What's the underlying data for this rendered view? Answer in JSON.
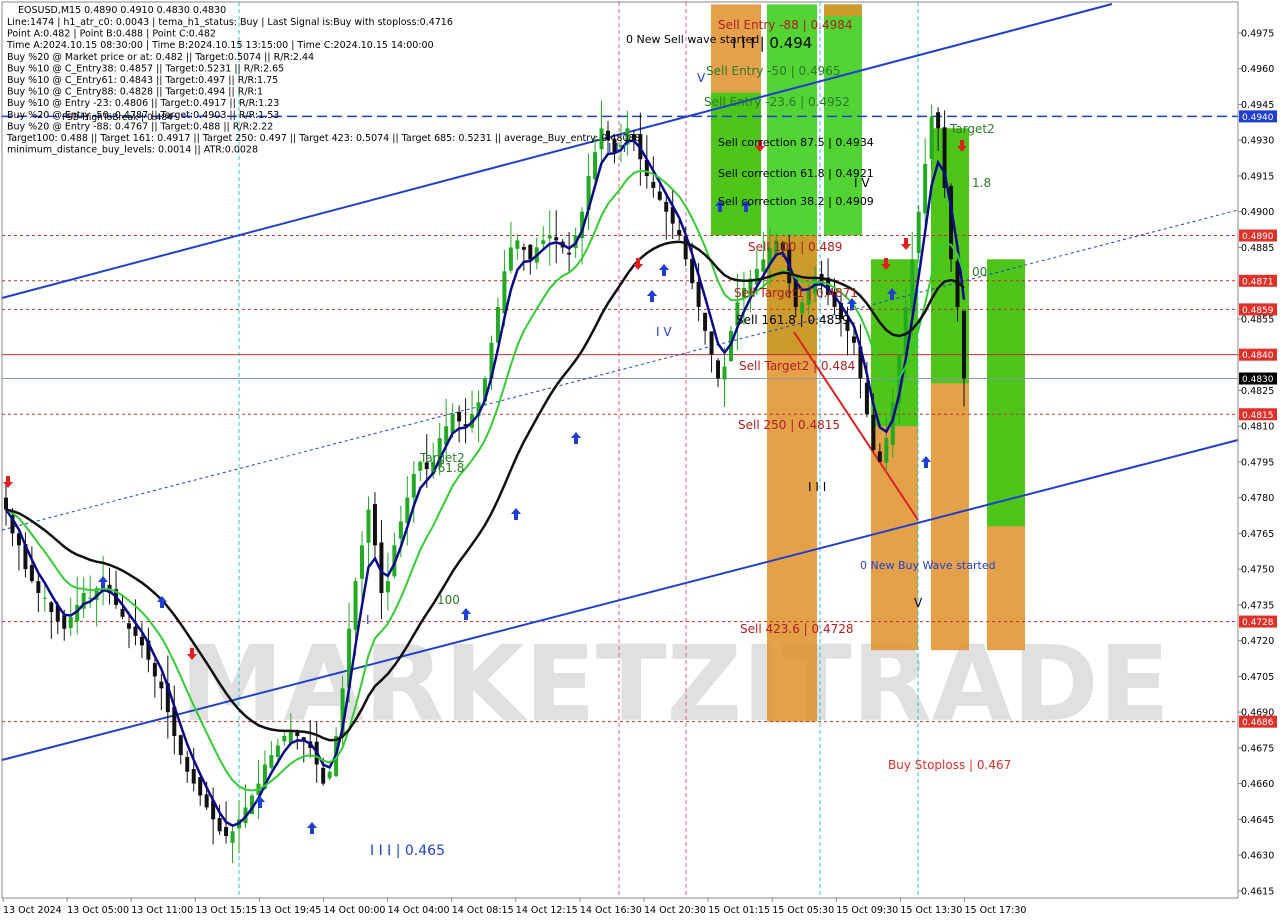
{
  "info": {
    "title": "EOSUSD,M15  0.4890 0.4910 0.4830 0.4830",
    "lines": [
      "Line:1474 | h1_atr_c0: 0.0043 | tema_h1_status: Buy | Last Signal is:Buy with stoploss:0.4716",
      "Point A:0.482 | Point B:0.488 | Point C:0.482",
      "Time A:2024.10.15 08:30:00 | Time B:2024.10.15 13:15:00 | Time C:2024.10.15 14:00:00",
      "Buy %20 @ Market price or at: 0.482 || Target:0.5074 || R/R:2.44",
      "Buy %10 @ C_Entry38: 0.4857 || Target:0.5231 || R/R:2.65",
      "Buy %10 @ C_Entry61: 0.4843 || Target:0.497 || R/R:1.75",
      "Buy %10 @ C_Entry88: 0.4828 || Target:0.494 || R/R:1",
      "Buy %10 @ Entry -23: 0.4806 || Target:0.4917 || R/R:1.23",
      "Buy %20 @ Entry -50: 0.4787 || Target:0.4903 || R/R:1.53",
      "Buy %20 @ Entry -88: 0.4767 || Target:0.488 || R/R:2.22",
      "Target100: 0.488 || Target 161: 0.4917 || Target 250: 0.497 || Target 423: 0.5074 || Target 685: 0.5231 || average_Buy_entry: 0.48088",
      "minimum_distance_buy_levels: 0.0014 || ATR:0.0028"
    ]
  },
  "watermark": "MARKETZITRADE",
  "price_labels": [
    {
      "text": "0.4940",
      "price": 0.494,
      "color": "#1f3fd0"
    },
    {
      "text": "0.4890",
      "price": 0.489,
      "color": "#e0302a"
    },
    {
      "text": "0.4871",
      "price": 0.4871,
      "color": "#e0302a"
    },
    {
      "text": "0.4859",
      "price": 0.4859,
      "color": "#e0302a"
    },
    {
      "text": "0.4840",
      "price": 0.484,
      "color": "#e0302a"
    },
    {
      "text": "0.4830",
      "price": 0.483,
      "color": "#000000"
    },
    {
      "text": "0.4815",
      "price": 0.4815,
      "color": "#e0302a"
    },
    {
      "text": "0.4728",
      "price": 0.4728,
      "color": "#e0302a"
    },
    {
      "text": "0.4686",
      "price": 0.4686,
      "color": "#e0302a"
    }
  ],
  "chart_annotations": {
    "new_sell_wave": "0 New Sell wave started",
    "new_buy_wave": "0 New Buy Wave started",
    "sell_entry_88": "Sell Entry -88 | 0.4984",
    "iii_494": "I I I | 0.494",
    "sell_entry_50": "Sell Entry -50 | 0.4965",
    "sell_entry_236": "Sell Entry -23.6 | 0.4952",
    "sell_corr_875": "Sell correction 87.5 | 0.4934",
    "sell_corr_618": "Sell correction 61.8 | 0.4921",
    "sell_corr_382": "Sell correction 38.2 | 0.4909",
    "sell_100": "Sell 100 | 0.489",
    "sell_target1": "Sell Target1 | 0.4871",
    "sell_1618": "Sell 161.8 | 0.4859",
    "sell_target2": "Sell Target2 | 0.484",
    "sell_250": "Sell 250 | 0.4815",
    "sell_4236": "Sell 423.6 | 0.4728",
    "buy_stoploss": "Buy Stoploss | 0.467",
    "iii_465": "I I I | 0.465",
    "target2_left": "Target2",
    "t1618_left": "161.8",
    "t100_left": "100",
    "target2_right": "Target2",
    "t18_right": "1.8",
    "t00_right": "00",
    "wave_iii": "I I I",
    "wave_iv": "I V",
    "wave_v": "V",
    "wave_i": "I",
    "wave_iii_2": "I I I",
    "wave_iv_2": "I V",
    "wave_v_2": "V",
    "ema_label": "FSB-HighToBreak | 0.484"
  },
  "colors": {
    "up_candle": "#22aa22",
    "down_candle": "#111111",
    "ma_fast": "#0a0a8a",
    "ma_mid": "#33cc33",
    "ma_slow": "#111111",
    "channel": "#1f3fd0",
    "sell_level": "#e0302a",
    "zone_green": "#33cc11",
    "zone_orange": "#e0902a"
  },
  "chart_data": {
    "type": "candlestick",
    "symbol": "EOSUSD",
    "timeframe": "M15",
    "ylim": [
      0.4612,
      0.4988
    ],
    "y_ticks": [
      0.4975,
      0.496,
      0.4945,
      0.493,
      0.4915,
      0.49,
      0.4885,
      0.487,
      0.4855,
      0.484,
      0.4825,
      0.481,
      0.4795,
      0.478,
      0.4765,
      0.475,
      0.4735,
      0.472,
      0.4705,
      0.469,
      0.4675,
      0.466,
      0.4645,
      0.463,
      0.4615
    ],
    "x_ticks": [
      "13 Oct 2024",
      "13 Oct 05:00",
      "13 Oct 11:00",
      "13 Oct 15:15",
      "13 Oct 19:45",
      "14 Oct 00:00",
      "14 Oct 04:00",
      "14 Oct 08:15",
      "14 Oct 12:15",
      "14 Oct 16:30",
      "14 Oct 20:30",
      "15 Oct 01:15",
      "15 Oct 05:30",
      "15 Oct 09:30",
      "15 Oct 13:30",
      "15 Oct 17:30"
    ],
    "close_path": [
      0.4775,
      0.4765,
      0.476,
      0.475,
      0.4745,
      0.474,
      0.4738,
      0.4732,
      0.4728,
      0.4725,
      0.473,
      0.4735,
      0.474,
      0.4738,
      0.4742,
      0.4745,
      0.474,
      0.4735,
      0.473,
      0.4725,
      0.4722,
      0.4718,
      0.4712,
      0.4705,
      0.47,
      0.469,
      0.468,
      0.4672,
      0.4665,
      0.466,
      0.4655,
      0.465,
      0.4645,
      0.464,
      0.4638,
      0.464,
      0.4645,
      0.465,
      0.4655,
      0.466,
      0.4668,
      0.4672,
      0.4676,
      0.468,
      0.4682,
      0.468,
      0.4678,
      0.4675,
      0.4668,
      0.466,
      0.4665,
      0.468,
      0.47,
      0.4725,
      0.4745,
      0.476,
      0.4775,
      0.476,
      0.474,
      0.4745,
      0.476,
      0.477,
      0.478,
      0.479,
      0.4795,
      0.4792,
      0.4795,
      0.4805,
      0.481,
      0.4815,
      0.4812,
      0.481,
      0.4815,
      0.482,
      0.483,
      0.4845,
      0.486,
      0.4875,
      0.4885,
      0.4888,
      0.4884,
      0.488,
      0.4885,
      0.4888,
      0.489,
      0.4888,
      0.4885,
      0.4882,
      0.489,
      0.49,
      0.4915,
      0.4925,
      0.4935,
      0.493,
      0.4925,
      0.4928,
      0.4935,
      0.493,
      0.4922,
      0.4915,
      0.491,
      0.4905,
      0.49,
      0.4895,
      0.489,
      0.488,
      0.487,
      0.486,
      0.485,
      0.484,
      0.483,
      0.4835,
      0.485,
      0.4862,
      0.4868,
      0.4872,
      0.4876,
      0.488,
      0.4885,
      0.4888,
      0.4884,
      0.487,
      0.486,
      0.4862,
      0.4868,
      0.4872,
      0.487,
      0.4865,
      0.486,
      0.4855,
      0.485,
      0.4845,
      0.483,
      0.4815,
      0.48,
      0.4795,
      0.4805,
      0.482,
      0.484,
      0.486,
      0.488,
      0.49,
      0.492,
      0.494,
      0.4935,
      0.491,
      0.488,
      0.486,
      0.483
    ]
  }
}
